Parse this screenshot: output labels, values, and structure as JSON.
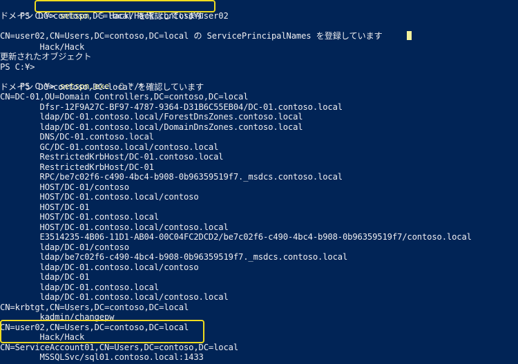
{
  "window": {
    "app": "PowerShell"
  },
  "console": {
    "cmd1": {
      "prompt": "PS C:¥> ",
      "command": "setspn",
      "param": " -S",
      "args": " Hack/Hack contoso¥user02"
    },
    "out1": [
      "ドメイン DC=contoso,DC=local を確認しています",
      "",
      "CN=user02,CN=Users,DC=contoso,DC=local の ServicePrincipalNames を登録しています",
      "        Hack/Hack",
      "更新されたオブジェクト"
    ],
    "prompt_empty": "PS C:¥>",
    "cmd2": {
      "prompt": "PS C:¥> ",
      "command": "setspn.exe",
      "param": " -Q",
      "args": " */*"
    },
    "out2": [
      "ドメイン DC=contoso,DC=local を確認しています",
      "CN=DC-01,OU=Domain Controllers,DC=contoso,DC=local",
      "        Dfsr-12F9A27C-BF97-4787-9364-D31B6C55EB04/DC-01.contoso.local",
      "        ldap/DC-01.contoso.local/ForestDnsZones.contoso.local",
      "        ldap/DC-01.contoso.local/DomainDnsZones.contoso.local",
      "        DNS/DC-01.contoso.local",
      "        GC/DC-01.contoso.local/contoso.local",
      "        RestrictedKrbHost/DC-01.contoso.local",
      "        RestrictedKrbHost/DC-01",
      "        RPC/be7c02f6-c490-4bc4-b908-0b96359519f7._msdcs.contoso.local",
      "        HOST/DC-01/contoso",
      "        HOST/DC-01.contoso.local/contoso",
      "        HOST/DC-01",
      "        HOST/DC-01.contoso.local",
      "        HOST/DC-01.contoso.local/contoso.local",
      "        E3514235-4B06-11D1-AB04-00C04FC2DCD2/be7c02f6-c490-4bc4-b908-0b96359519f7/contoso.local",
      "        ldap/DC-01/contoso",
      "        ldap/be7c02f6-c490-4bc4-b908-0b96359519f7._msdcs.contoso.local",
      "        ldap/DC-01.contoso.local/contoso",
      "        ldap/DC-01",
      "        ldap/DC-01.contoso.local",
      "        ldap/DC-01.contoso.local/contoso.local",
      "CN=krbtgt,CN=Users,DC=contoso,DC=local",
      "        kadmin/changepw",
      "CN=user02,CN=Users,DC=contoso,DC=local",
      "        Hack/Hack",
      "CN=ServiceAccount01,CN=Users,DC=contoso,DC=local",
      "        MSSQLSvc/sql01.contoso.local:1433"
    ]
  },
  "colors": {
    "background": "#012456",
    "text": "#eeedf0",
    "command": "#f3f19c",
    "parameter": "#9aa0a8",
    "highlight_box": "#f0dc1e"
  }
}
